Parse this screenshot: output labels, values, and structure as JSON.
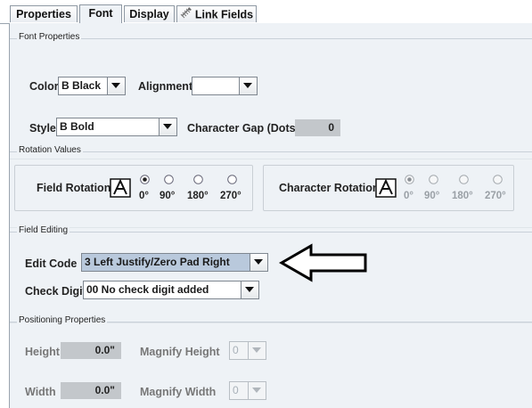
{
  "tabs": [
    {
      "label": "Properties",
      "active": false
    },
    {
      "label": "Font",
      "active": true
    },
    {
      "label": "Display",
      "active": false
    },
    {
      "label": "Link Fields",
      "active": false,
      "icon": "link-icon"
    }
  ],
  "font_properties": {
    "title": "Font Properties",
    "color_label": "Color",
    "color_value": "B Black",
    "alignment_label": "Alignment",
    "alignment_value": "",
    "style_label": "Style",
    "style_value": "B Bold",
    "char_gap_label": "Character Gap (Dots)",
    "char_gap_value": "0"
  },
  "rotation": {
    "title": "Rotation Values",
    "field_label": "Field Rotation",
    "char_label": "Character Rotation",
    "options": [
      "0°",
      "90°",
      "180°",
      "270°"
    ],
    "field_selected": 0,
    "char_selected": 0
  },
  "field_editing": {
    "title": "Field Editing",
    "edit_code_label": "Edit Code",
    "edit_code_value": "3 Left Justify/Zero Pad Right",
    "check_digit_label": "Check Digit",
    "check_digit_value": "00 No check digit added"
  },
  "positioning": {
    "title": "Positioning Properties",
    "height_label": "Height",
    "height_value": "0.0\"",
    "magnify_height_label": "Magnify Height",
    "magnify_height_value": "0",
    "width_label": "Width",
    "width_value": "0.0\"",
    "magnify_width_label": "Magnify Width",
    "magnify_width_value": "0"
  },
  "colors": {
    "panel_bg": "#eef2f6",
    "highlight": "#b9c9dc",
    "readonly_field": "#c3c7cb"
  }
}
